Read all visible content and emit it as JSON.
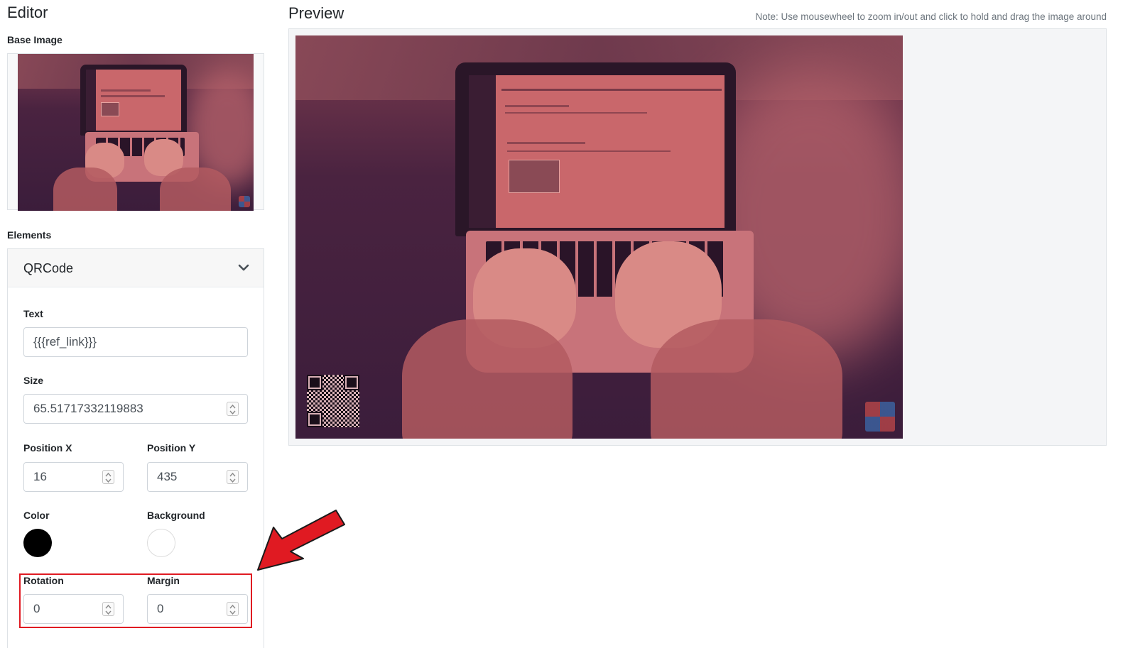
{
  "editor": {
    "title": "Editor",
    "base_image_label": "Base Image",
    "elements_label": "Elements"
  },
  "preview": {
    "title": "Preview",
    "note": "Note: Use mousewheel to zoom in/out and click to hold and drag the image around"
  },
  "element_panel": {
    "name": "QRCode",
    "fields": {
      "text": {
        "label": "Text",
        "value": "{{{ref_link}}}"
      },
      "size": {
        "label": "Size",
        "value": "65.51717332119883"
      },
      "position_x": {
        "label": "Position X",
        "value": "16"
      },
      "position_y": {
        "label": "Position Y",
        "value": "435"
      },
      "color": {
        "label": "Color",
        "value": "#000000"
      },
      "background": {
        "label": "Background",
        "value": "#ffffff"
      },
      "rotation": {
        "label": "Rotation",
        "value": "0"
      },
      "margin": {
        "label": "Margin",
        "value": "0"
      }
    }
  },
  "colors": {
    "highlight": "#e01a22",
    "image_tint": "#7a3a4e"
  },
  "icons": [
    "chevron-down-icon",
    "spinner-icon",
    "qr-code-icon",
    "puzzle-logo-icon",
    "red-arrow-annotation"
  ]
}
